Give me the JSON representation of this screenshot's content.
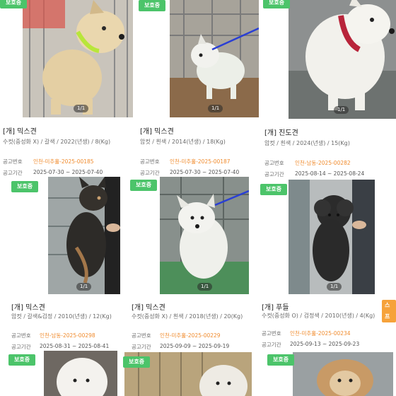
{
  "colors": {
    "badge_green": "#4cc46a",
    "badge_orange": "#f6a23a",
    "notice_orange": "#f08b2d"
  },
  "labels": {
    "notice_no": "공고번호",
    "notice_period": "공고기간"
  },
  "cards": [
    {
      "badge": "보호중",
      "counter": "1/1",
      "title": "[개] 믹스견",
      "info": "수컷(중성화 X) / 갈색 / 2022(년생) / 8(Kg)",
      "notice_no": "인천-미추홀-2025-00185",
      "period": "2025-07-30 ~ 2025-07-40"
    },
    {
      "badge": "보호중",
      "counter": "1/1",
      "title": "[개] 믹스견",
      "info": "암컷 / 흰색 / 2014(년생) / 18(Kg)",
      "notice_no": "인천-미추홀-2025-00187",
      "period": "2025-07-30 ~ 2025-07-40"
    },
    {
      "badge": "보호중",
      "counter": "1/1",
      "title": "[개] 진도견",
      "info": "암컷 / 흰색 / 2024(년생) / 15(Kg)",
      "notice_no": "인천-남동-2025-00282",
      "period": "2025-08-14 ~ 2025-08-24"
    },
    {
      "badge": "보호중",
      "counter": "1/1",
      "title": "[개] 믹스견",
      "info": "암컷 / 갈색&검정 / 2010(년생) / 12(Kg)",
      "notice_no": "인천-남동-2025-00298",
      "period": "2025-08-31 ~ 2025-08-41"
    },
    {
      "badge": "보호중",
      "counter": "1/1",
      "title": "[개] 믹스견",
      "info": "수컷(중성화 X) / 흰색 / 2018(년생) / 20(Kg)",
      "notice_no": "인천-미추홀-2025-00229",
      "period": "2025-09-09 ~ 2025-09-19"
    },
    {
      "badge": "보호중",
      "counter": "1/1",
      "title": "[개] 푸들",
      "info": "수컷(중성화 O) / 검정색 / 2010(년생) / 4(Kg)",
      "notice_no": "인천-미추홀-2025-00234",
      "period": "2025-09-13 ~ 2025-09-23",
      "side_badge": "스프"
    },
    {
      "badge": "보호중"
    },
    {
      "badge": "보호중"
    },
    {
      "badge": "보호중"
    }
  ]
}
